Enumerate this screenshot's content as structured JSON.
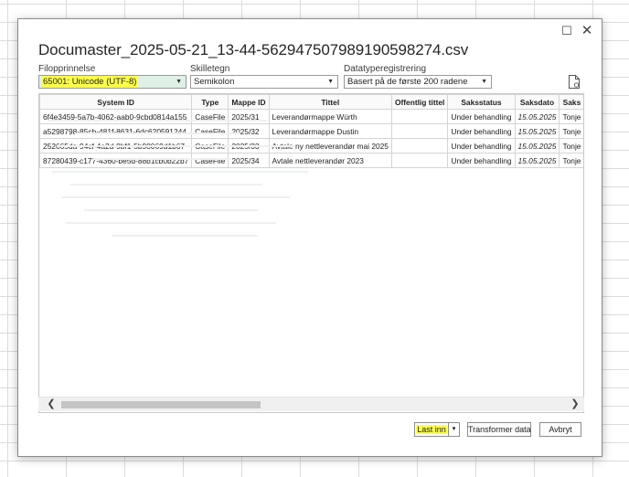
{
  "dialog": {
    "title": "Documaster_2025-05-21_13-44-562947507989190598274.csv",
    "maximize_glyph": "☐",
    "close_glyph": "✕"
  },
  "options": {
    "file_origin": {
      "label": "Filopprinnelse",
      "value": "65001: Unicode (UTF-8)"
    },
    "delimiter": {
      "label": "Skilletegn",
      "value": "Semikolon"
    },
    "datatype": {
      "label": "Datatyperegistrering",
      "value": "Basert på de første 200 radene"
    }
  },
  "icons": {
    "dropdown": "chevron-down-icon",
    "document": "document-settings-icon",
    "scroll_left": "chevron-left-icon",
    "scroll_right": "chevron-right-icon"
  },
  "table": {
    "columns": [
      "System ID",
      "Type",
      "Mappe ID",
      "Tittel",
      "Offentlig tittel",
      "Saksstatus",
      "Saksdato",
      "Saks"
    ],
    "rows": [
      [
        "6f4e3459-5a7b-4062-aab0-9cbd0814a155",
        "CaseFile",
        "2025/31",
        "Leverandørmappe Würth",
        "",
        "Under behandling",
        "15.05.2025",
        "Tonje"
      ],
      [
        "a5298798-85cb-481f-8631-6dc620591244",
        "CaseFile",
        "2025/32",
        "Leverandørmappe Dustin",
        "",
        "Under behandling",
        "15.05.2025",
        "Tonje"
      ],
      [
        "252665da-94cf-4a2d-9bf1-5b98069d1b67",
        "CaseFile",
        "2025/33",
        "Avtale ny nettleverandør mai 2025",
        "",
        "Under behandling",
        "15.05.2025",
        "Tonje"
      ],
      [
        "87280439-c177-4360-be5d-88b1cb0b22b7",
        "CaseFile",
        "2025/34",
        "Avtale nettleverandør 2023",
        "",
        "Under behandling",
        "15.05.2025",
        "Tonje"
      ]
    ]
  },
  "scrollbar": {
    "left_glyph": "❮",
    "right_glyph": "❯"
  },
  "buttons": {
    "load": "Last inn",
    "load_more_glyph": "▾",
    "transform": "Transformer data",
    "cancel": "Avbryt"
  },
  "colors": {
    "highlight": "#fcff4c",
    "selected_field": "#dff1e6",
    "gridline": "#dadcdf"
  }
}
